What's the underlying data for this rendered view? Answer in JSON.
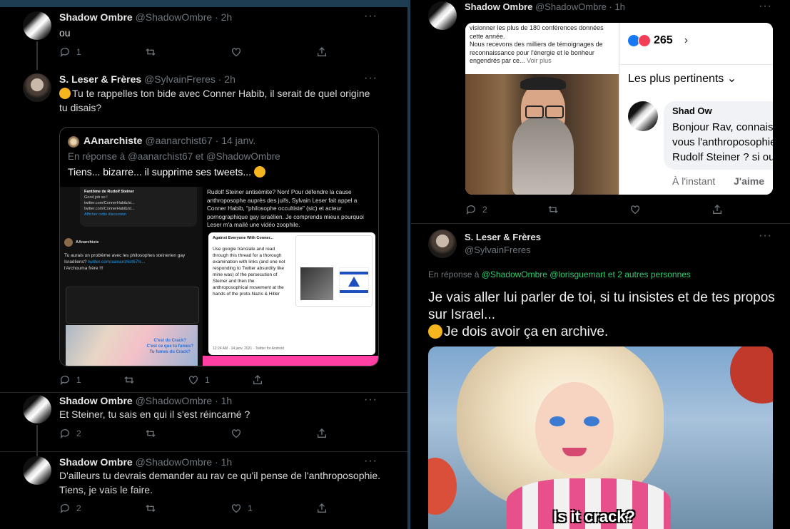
{
  "left": {
    "tweet1": {
      "name": "Shadow Ombre",
      "handle": "@ShadowOmbre",
      "time": "· 2h",
      "text": "ou",
      "replies": "1",
      "likes": "",
      "more": "···"
    },
    "tweet2": {
      "name": "S. Leser & Frères",
      "handle": "@SylvainFreres",
      "time": "· 2h",
      "text": "Tu te rappelles ton bide avec Conner Habib, il serait de quel origine tu disais?",
      "replies": "1",
      "likes": "1",
      "more": "···",
      "quote": {
        "name": "AAnarchiste",
        "handle": "@aanarchist67",
        "time": "· 14 janv.",
        "reply_prefix": "En réponse à",
        "reply_to": "@aanarchist67",
        "reply_and": "et",
        "reply_to2": "@ShadowOmbre",
        "text": "Tiens... bizarre... il supprime ses tweets...",
        "screenshot": {
          "fantome": "Fantôme de Rudolf Steiner",
          "good_job": "Good job so !",
          "link1": "twitter.com/ConnerHabib/st...",
          "link2": "twitter.com/ConnerHabib/st...",
          "discussion": "Afficher cette discussion",
          "inner_text": "Tu aurais un problème avec les philosophes steinerien gay Israéliens?",
          "inner_link": "twitter.com/aanarchist67/s...",
          "archouma": "l'Archouma frère !!!",
          "right_text": "Rudolf Steiner antisémite? Non! Pour défendre la cause anthroposophe auprès des juifs, Sylvain Leser fait appel a Conner Habib, \"philosophe occultiste\" (sic) et acteur pornographique gay israélien. Je comprends mieux pourquoi Leser m'a mailé une vidéo zoophile.",
          "card_title": "Against Everyone With Conner...",
          "card_text": "Use google translate and read through this thread for a thorough examination with links (and one not responding to Twitter absurdity like mine was) of the persecution of Steiner and then the anthroposophical movement at the hands of the proto-Nazis & Hitler",
          "card_date": "12:24 AM · 14 janv. 2021 · Twitter for Android",
          "crack1": "C'est du Crack?",
          "crack2": "C'est ce que tu fumes?",
          "crack3": "Tu fumes du Crack?"
        }
      }
    },
    "tweet3": {
      "name": "Shadow Ombre",
      "handle": "@ShadowOmbre",
      "time": "· 1h",
      "text": "Et Steiner, tu sais en qui il s'est réincarné ?",
      "replies": "2",
      "more": "···"
    },
    "tweet4": {
      "name": "Shadow Ombre",
      "handle": "@ShadowOmbre",
      "time": "· 1h",
      "text": "D'ailleurs tu devrais demander au rav ce qu'il pense de l'anthroposophie.\nTiens, je vais le faire.",
      "replies": "2",
      "likes": "1",
      "more": "···"
    }
  },
  "right": {
    "tweet1": {
      "name": "Shadow Ombre",
      "handle": "@ShadowOmbre",
      "time": "· 1h",
      "replies": "2",
      "more": "···",
      "fb": {
        "text": "visionner les plus de 180 conférences données cette année.\nNous recevons des milliers de témoignages de reconnaissance pour l'énergie et le bonheur engendrés par ce...",
        "voir_plus": "Voir plus",
        "reactions": "265",
        "sort": "Les plus pertinents",
        "commenter": "Shad Ow",
        "comment": "Bonjour Rav, connaissez-vous l'anthroposophie de Rudolf Steiner ? si oui : qu'en pensez-vous ?",
        "time": "À l'instant",
        "like": "J'aime"
      }
    },
    "tweet2": {
      "name": "S. Leser & Frères",
      "handle": "@SylvainFreres",
      "more": "···",
      "reply_prefix": "En réponse à",
      "reply_links": "@ShadowOmbre @lorisguemart",
      "reply_others": "et 2 autres personnes",
      "text1": "Je vais aller lui parler de toi, si tu insistes et de tes propos sur Israel...",
      "text2": "Je dois avoir ça en archive.",
      "caption": "Is it crack?"
    }
  },
  "colors": {
    "bg": "#000000",
    "accent": "#1d9bf0",
    "muted": "#6e767d",
    "pink": "#ff3fa4"
  }
}
